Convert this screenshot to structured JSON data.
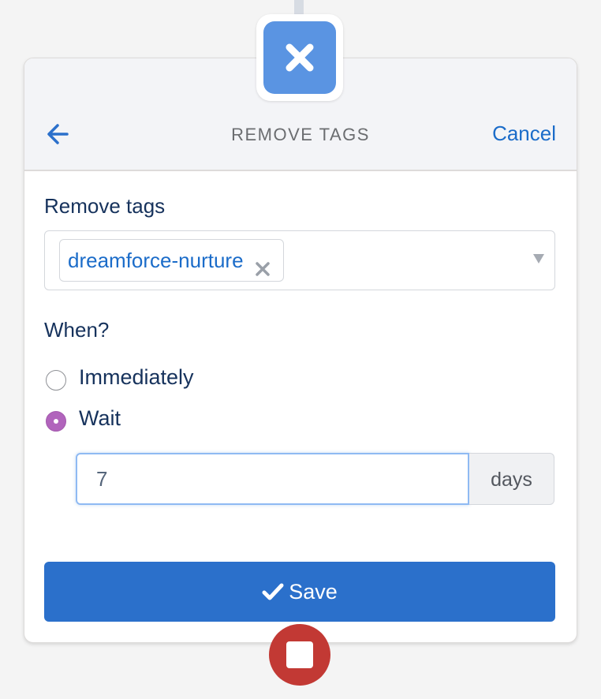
{
  "header": {
    "title": "REMOVE TAGS",
    "cancel_label": "Cancel",
    "back_icon": "arrow-left-icon",
    "node_icon": "close-icon"
  },
  "remove_tags": {
    "label": "Remove tags",
    "selected_tags": [
      "dreamforce-nurture"
    ],
    "remove_icon": "close-icon",
    "caret_icon": "caret-down-icon"
  },
  "when": {
    "label": "When?",
    "options": [
      {
        "label": "Immediately",
        "checked": false
      },
      {
        "label": "Wait",
        "checked": true
      }
    ],
    "wait_value": "7",
    "wait_unit": "days"
  },
  "save": {
    "label": "Save",
    "icon": "check-icon"
  },
  "colors": {
    "accent": "#2b70cb",
    "link": "#1b6cc9",
    "node_icon_bg": "#5a94e2",
    "radio_checked": "#b164bc",
    "end_node": "#c23934"
  }
}
